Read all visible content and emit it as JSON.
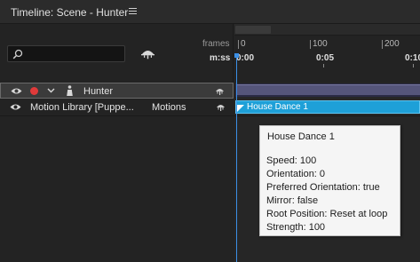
{
  "panel": {
    "title": "Timeline: Scene - Hunter",
    "menu_icon": "hamburger-icon"
  },
  "controls": {
    "search_placeholder": "",
    "search_icon": "search-icon",
    "filter_icon": "puppet-filter-icon",
    "frames_label": "frames",
    "time_label": "m:ss"
  },
  "ruler": {
    "frame_ticks": [
      "0",
      "100",
      "200"
    ],
    "time_ticks": [
      "0:00",
      "0:05",
      "0:10"
    ]
  },
  "tracks": [
    {
      "name": "Hunter",
      "type": "puppet",
      "armed": true
    },
    {
      "name": "Motion Library [Puppe...",
      "tag": "Motions"
    }
  ],
  "clip": {
    "label": "House Dance 1"
  },
  "tooltip": {
    "title": "House Dance 1",
    "lines": [
      "Speed: 100",
      "Orientation: 0",
      "Preferred Orientation: true",
      "Mirror: false",
      "Root Position: Reset at loop",
      "Strength: 100"
    ]
  },
  "colors": {
    "background": "#232323",
    "clip": "#1ea0d8",
    "playhead": "#3b8fe6",
    "record": "#e03a3a",
    "track_bar": "#55557a"
  }
}
